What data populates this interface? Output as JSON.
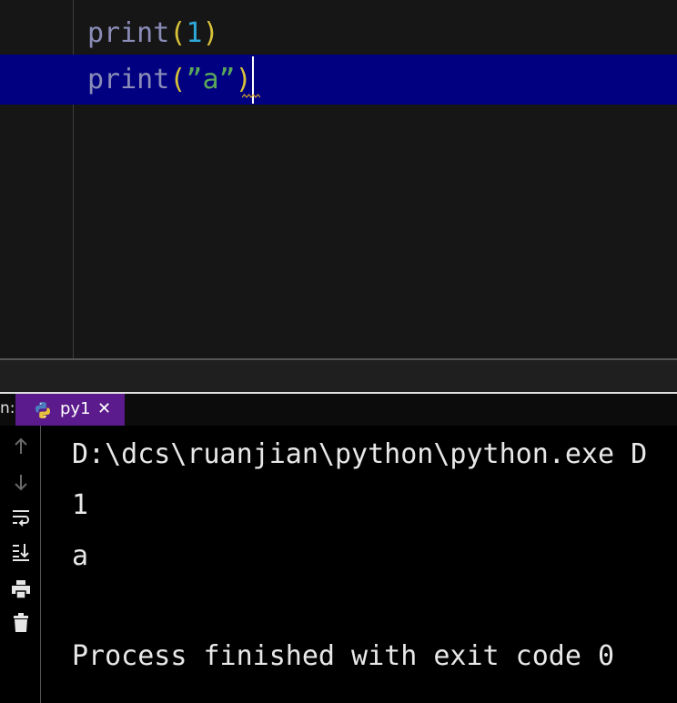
{
  "editor": {
    "lines": [
      {
        "fn": "print",
        "open": "(",
        "arg": "1",
        "close": ")"
      },
      {
        "fn": "print",
        "open": "(",
        "quote_open": "”",
        "arg": "a",
        "quote_close": "”",
        "close": ")"
      }
    ]
  },
  "run_panel": {
    "prefix": "n:",
    "tab_label": "py1",
    "close_glyph": "✕"
  },
  "toolbar": {
    "icons": [
      "arrow-up-icon",
      "arrow-down-icon",
      "soft-wrap-icon",
      "scroll-to-end-icon",
      "print-icon",
      "trash-icon"
    ]
  },
  "console": {
    "lines": [
      "D:\\dcs\\ruanjian\\python\\python.exe D",
      "1",
      "a",
      "",
      "Process finished with exit code 0"
    ]
  },
  "colors": {
    "editor_bg": "#161616",
    "current_line": "#000080",
    "tab_active": "#5b1b8c",
    "console_bg": "#000000"
  }
}
